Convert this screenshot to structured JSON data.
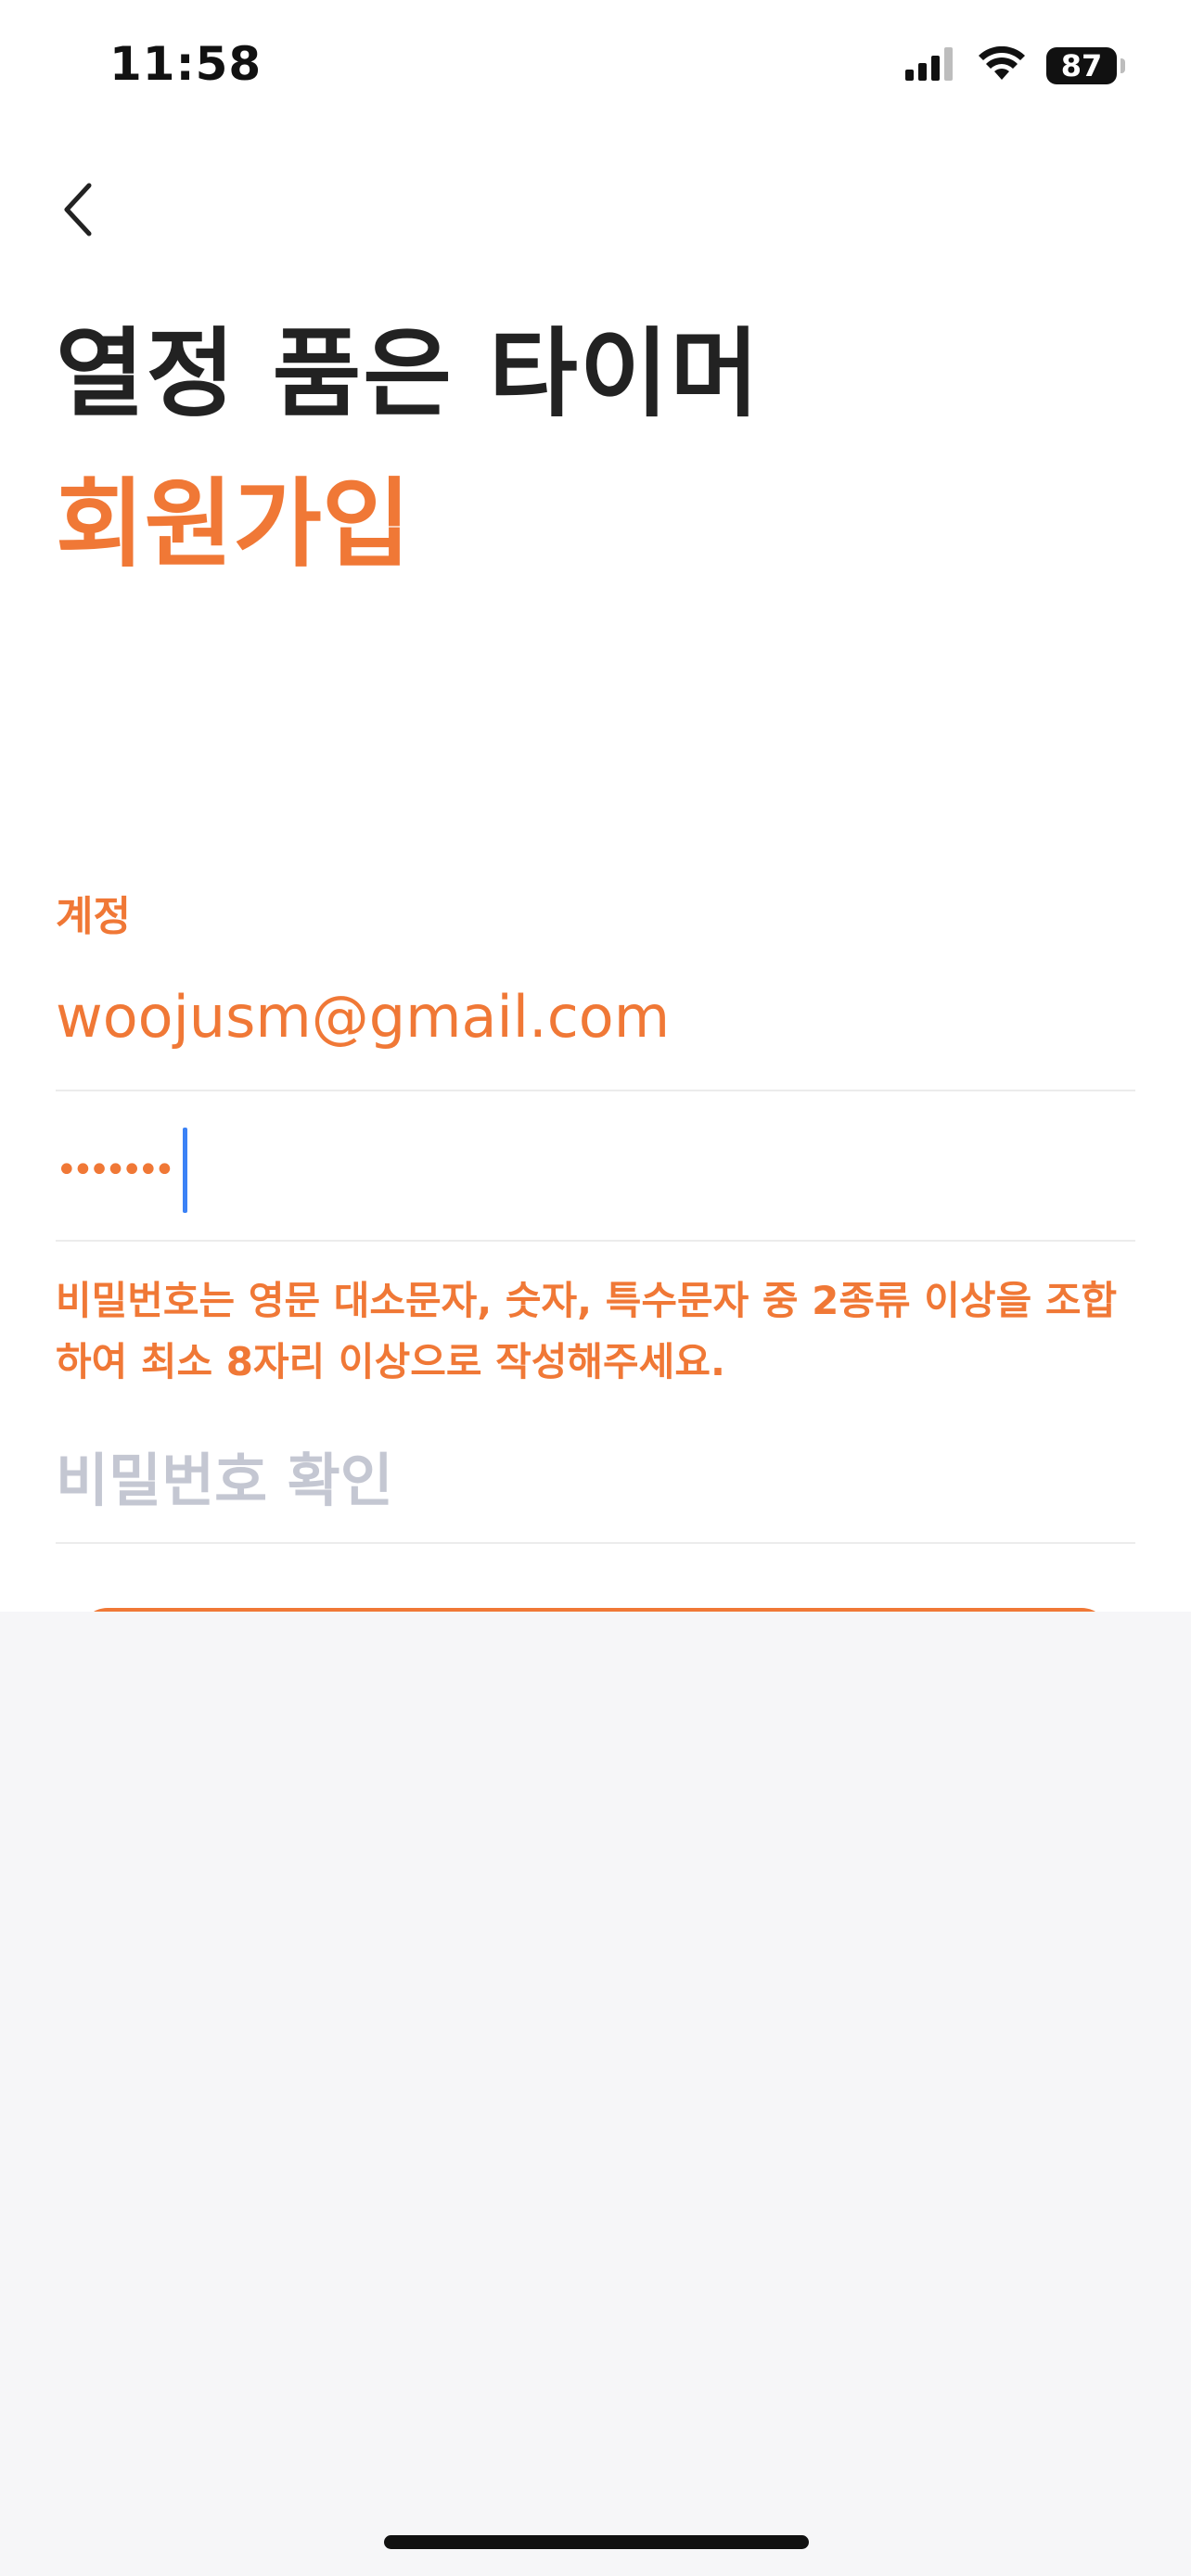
{
  "status_bar": {
    "time": "11:58",
    "battery": "87",
    "icons": [
      "cellular-signal-icon",
      "wifi-icon",
      "battery-icon"
    ]
  },
  "header": {
    "back_icon": "chevron-left-icon",
    "title": "열정 품은 타이머",
    "subtitle": "회원가입"
  },
  "form": {
    "account_label": "계정",
    "email_value": "woojusm@gmail.com",
    "password_value": "•••••••",
    "password_hint": "비밀번호는 영문 대소문자, 숫자, 특수문자 중 2종류 이상을 조합하여 최소 8자리 이상으로 작성해주세요.",
    "confirm_placeholder": "비밀번호 확인"
  },
  "colors": {
    "accent": "#f07836",
    "title": "#222222",
    "placeholder": "#c4c7d2",
    "caret": "#3b82f6",
    "divider": "#ececec",
    "keyboard_area": "#f6f6f8"
  }
}
